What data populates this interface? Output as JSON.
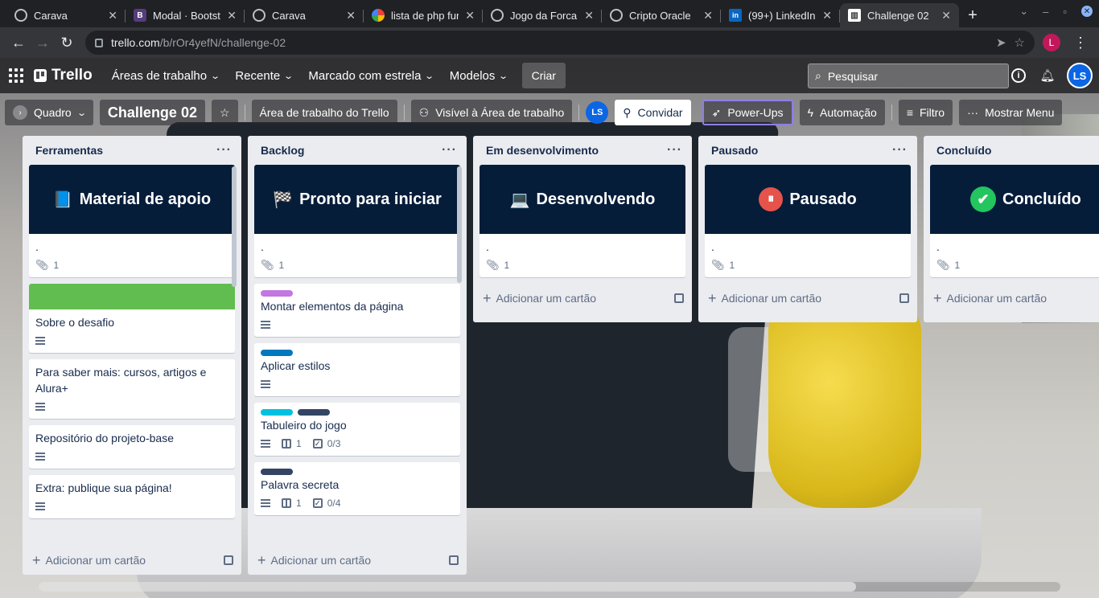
{
  "browser": {
    "tabs": [
      {
        "title": "Carava",
        "icon": "globe-icon",
        "active": false
      },
      {
        "title": "Modal · Bootstrap",
        "icon": "bootstrap-icon",
        "active": false
      },
      {
        "title": "Carava",
        "icon": "globe-icon",
        "active": false
      },
      {
        "title": "lista de php fun",
        "icon": "google-icon",
        "active": false
      },
      {
        "title": "Jogo da Forca",
        "icon": "globe-icon",
        "active": false
      },
      {
        "title": "Cripto Oracle",
        "icon": "globe-icon",
        "active": false
      },
      {
        "title": "(99+) LinkedIn",
        "icon": "linkedin-icon",
        "active": false
      },
      {
        "title": "Challenge 02",
        "icon": "trello-icon",
        "active": true
      }
    ],
    "url_host": "trello.com",
    "url_path": "/b/rOr4yefN/challenge-02",
    "profile_initial": "L"
  },
  "header": {
    "logo": "Trello",
    "menus": [
      "Áreas de trabalho",
      "Recente",
      "Marcado com estrela",
      "Modelos"
    ],
    "create": "Criar",
    "search_placeholder": "Pesquisar",
    "avatar": "LS"
  },
  "boardbar": {
    "view": "Quadro",
    "title": "Challenge 02",
    "workspace": "Área de trabalho do Trello",
    "visibility": "Visível à Área de trabalho",
    "member": "LS",
    "invite": "Convidar",
    "powerups": "Power-Ups",
    "automation": "Automação",
    "filter": "Filtro",
    "menu": "Mostrar Menu"
  },
  "lists": [
    {
      "title": "Ferramentas",
      "cover": {
        "text": "Material de apoio",
        "emoji": "📘"
      },
      "cover_card": {
        "title": ".",
        "attachments": "1"
      },
      "cards": [
        {
          "title": "Sobre o desafio"
        },
        {
          "title": "Para saber mais: cursos, artigos e Alura+"
        },
        {
          "title": "Repositório do projeto-base"
        },
        {
          "title": "Extra: publique sua página!"
        }
      ],
      "add": "Adicionar um cartão"
    },
    {
      "title": "Backlog",
      "cover": {
        "text": "Pronto para iniciar",
        "emoji": "🏁"
      },
      "cover_card": {
        "title": ".",
        "attachments": "1"
      },
      "cards": [
        {
          "title": "Montar elementos da página",
          "labels": [
            "#c377e0"
          ]
        },
        {
          "title": "Aplicar estilos",
          "labels": [
            "#0079bf"
          ]
        },
        {
          "title": "Tabuleiro do jogo",
          "labels": [
            "#00c2e0",
            "#344563"
          ],
          "book": "1",
          "checklist": "0/3"
        },
        {
          "title": "Palavra secreta",
          "labels": [
            "#344563"
          ],
          "book": "1",
          "checklist": "0/4"
        }
      ],
      "add": "Adicionar um cartão"
    },
    {
      "title": "Em desenvolvimento",
      "cover": {
        "text": "Desenvolvendo",
        "emoji": "💻"
      },
      "cover_card": {
        "title": ".",
        "attachments": "1"
      },
      "add": "Adicionar um cartão"
    },
    {
      "title": "Pausado",
      "cover": {
        "text": "Pausado",
        "emoji": "⏸"
      },
      "cover_card": {
        "title": ".",
        "attachments": "1"
      },
      "add": "Adicionar um cartão"
    },
    {
      "title": "Concluído",
      "cover": {
        "text": "Concluído",
        "emoji": "✔"
      },
      "cover_card": {
        "title": ".",
        "attachments": "1"
      },
      "add": "Adicionar um cartão"
    }
  ]
}
